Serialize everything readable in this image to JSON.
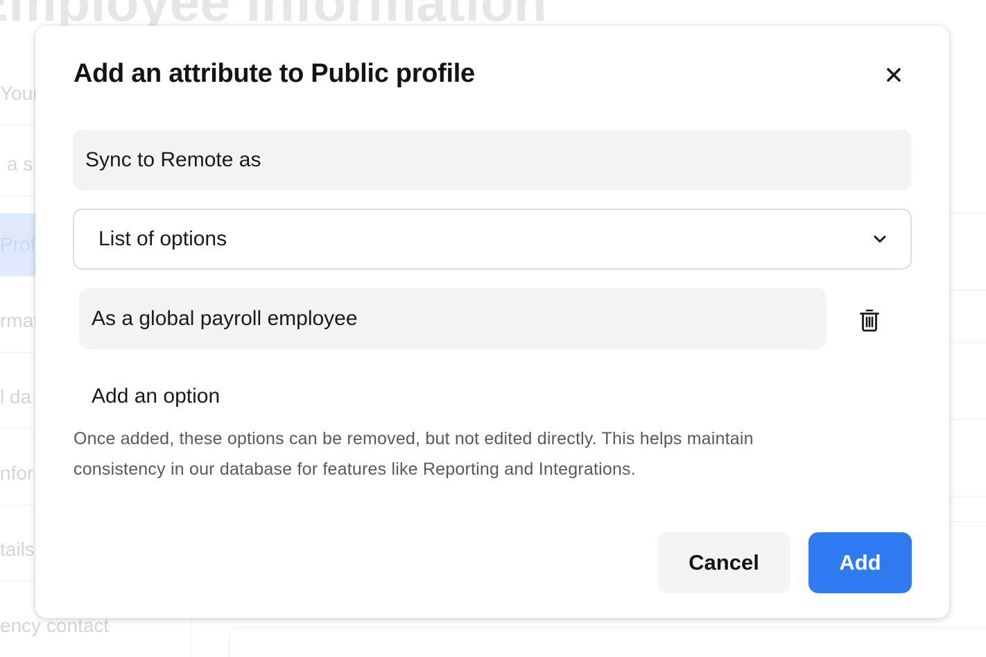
{
  "background": {
    "page_title": "Employee information",
    "sidebar_items": [
      "Your",
      "a s",
      "Profi",
      "rmat",
      "l da",
      "nfor",
      "tails",
      "ency contact"
    ]
  },
  "dialog": {
    "title": "Add an attribute to Public profile",
    "close_icon": "close-icon",
    "name_field": {
      "value": "Sync to Remote as"
    },
    "type_select": {
      "selected": "List of options",
      "icon": "chevron-down-icon"
    },
    "options": [
      {
        "value": "As a global payroll employee",
        "delete_icon": "trash-icon"
      }
    ],
    "add_option_label": "Add an option",
    "help_text": "Once added, these options can be removed, but not edited directly. This helps maintain consistency in our database for features like Reporting and Integrations.",
    "cancel_label": "Cancel",
    "add_label": "Add"
  },
  "colors": {
    "primary": "#2f7cf0",
    "field_background": "#f4f4f4",
    "text": "#141414",
    "muted_text": "#595959"
  }
}
